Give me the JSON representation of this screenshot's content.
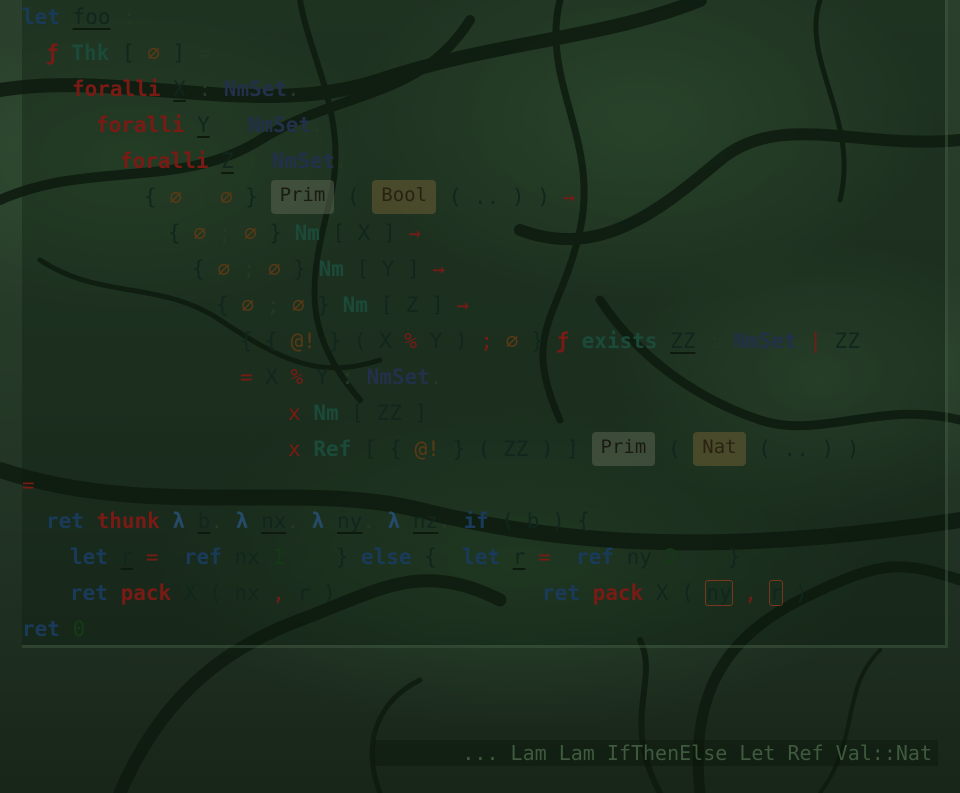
{
  "code": {
    "l1": {
      "kw": "let",
      "name": "foo",
      "colon": " :"
    },
    "l2": {
      "f": "ƒ",
      "thk": "Thk",
      "lb": "[",
      "phi": "∅",
      "rb": "]",
      "eq": "="
    },
    "l3": {
      "forall": "foralli",
      "var": "X",
      "colon": ":",
      "set": "NmSet",
      "dot": "."
    },
    "l4": {
      "forall": "foralli",
      "var": "Y",
      "colon": ":",
      "set": "NmSet",
      "dot": "."
    },
    "l5": {
      "forall": "foralli",
      "var": "Z",
      "colon": ":",
      "set": "NmSet",
      "dot": "."
    },
    "l6": {
      "lb": "{",
      "p1": "∅",
      "semi": ";",
      "p2": "∅",
      "rb": "}",
      "prim": "Prim",
      "lp": "(",
      "bool": "Bool",
      "dots": "( .. ) )",
      "arrow": "→"
    },
    "l7": {
      "lb": "{",
      "p1": "∅",
      "semi": ";",
      "p2": "∅",
      "rb": "}",
      "nm": "Nm",
      "rest": "[ X ]",
      "arrow": "→"
    },
    "l8": {
      "lb": "{",
      "p1": "∅",
      "semi": ";",
      "p2": "∅",
      "rb": "}",
      "nm": "Nm",
      "rest": "[ Y ]",
      "arrow": "→"
    },
    "l9": {
      "lb": "{",
      "p1": "∅",
      "semi": ";",
      "p2": "∅",
      "rb": "}",
      "nm": "Nm",
      "rest": "[ Z ]",
      "arrow": "→"
    },
    "l10": {
      "lb": "{ {",
      "at": "@!",
      "mid": "} ( X",
      "pct": "%",
      "mid2": "Y )",
      "semi": ";",
      "phi": "∅",
      "rb": "}",
      "f": "ƒ",
      "exists": "exists",
      "zz": "ZZ",
      "colon": ":",
      "set": "NmSet",
      "bar": "|",
      "zz2": "ZZ"
    },
    "l11": {
      "eq": "=",
      "x": "X",
      "pct": "%",
      "y": "Y",
      "colon": ":",
      "set": "NmSet",
      "dot": "."
    },
    "l12": {
      "x": "x",
      "nm": "Nm",
      "rest": "[ ZZ ]"
    },
    "l13": {
      "x": "x",
      "ref": "Ref",
      "lb": "[ {",
      "at": "@!",
      "mid": "} ( ZZ ) ]",
      "prim": "Prim",
      "lp": "(",
      "nat": "Nat",
      "rest": "( .. ) )"
    },
    "l14": {
      "eq": "="
    },
    "l15": {
      "ret": "ret",
      "thunk": "thunk",
      "lam": "λ",
      "b": "b",
      "dot": ".",
      "nx": "nx",
      "ny": "ny",
      "nz": "nz",
      "if": "if",
      "cond": "( b ) {"
    },
    "l16": {
      "let": "let",
      "r": "r",
      "eq": "=",
      "ref": "ref",
      "nx": "nx",
      "one": "1",
      "close": "}",
      "else": "else",
      "ob": "{",
      "let2": "let",
      "r2": "r",
      "eq2": "=",
      "ref2": "ref",
      "ny": "ny",
      "two": "2",
      "close2": "}"
    },
    "l17": {
      "ret": "ret",
      "pack": "pack",
      "x": "X ( nx",
      "comma": ",",
      "r": "r )",
      "ret2": "ret",
      "pack2": "pack",
      "x2": "X (",
      "ny": "ny",
      "comma2": ",",
      "r2": "r",
      "close": ")"
    },
    "l18": {
      "ret": "ret",
      "phi": "0"
    }
  },
  "status": {
    "text": "... Lam Lam IfThenElse Let Ref Val::Nat"
  }
}
